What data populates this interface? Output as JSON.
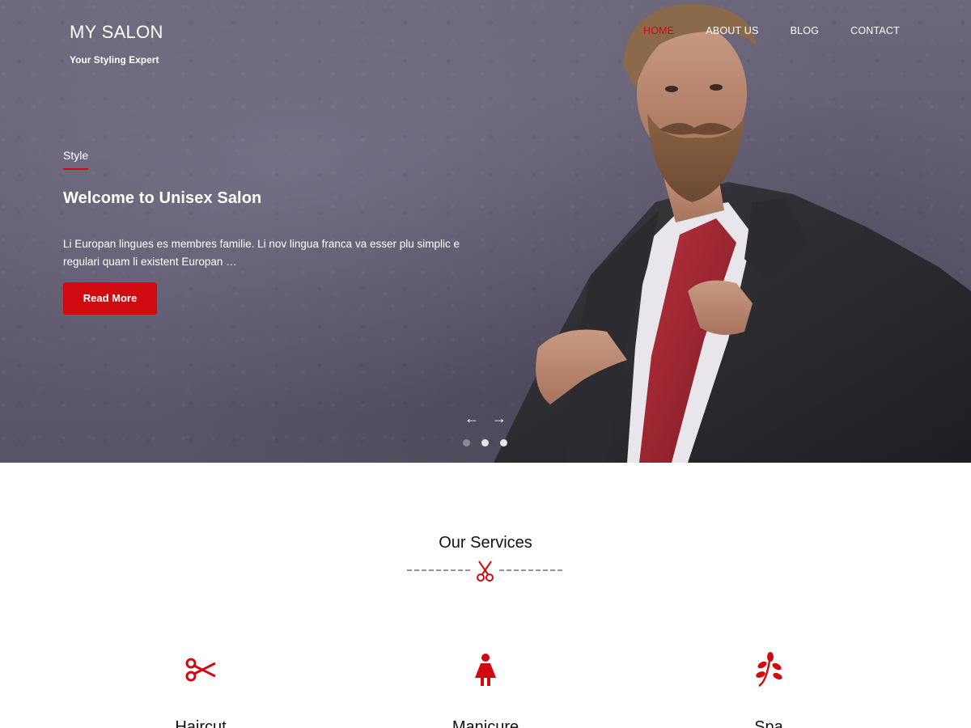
{
  "brand": {
    "title": "MY SALON",
    "tagline": "Your Styling Expert"
  },
  "nav": {
    "items": [
      {
        "label": "HOME",
        "active": true
      },
      {
        "label": "ABOUT US",
        "active": false
      },
      {
        "label": "BLOG",
        "active": false
      },
      {
        "label": "CONTACT",
        "active": false
      }
    ]
  },
  "slide": {
    "tag": "Style",
    "title": "Welcome to Unisex Salon",
    "description": "Li Europan lingues es membres familie. Li nov lingua franca va esser plu simplic e regulari quam li existent Europan …",
    "button_label": "Read More",
    "prev_arrow": "←",
    "next_arrow": "→",
    "dots": 3,
    "active_dot": 0
  },
  "services": {
    "title": "Our Services",
    "divider_icon": "scissors-icon",
    "items": [
      {
        "icon": "scissors-icon",
        "label": "Haircut"
      },
      {
        "icon": "woman-icon",
        "label": "Manicure"
      },
      {
        "icon": "leaf-icon",
        "label": "Spa"
      }
    ]
  },
  "colors": {
    "accent": "#d10a11",
    "hero_bg": "#625d71",
    "text": "#111111"
  }
}
